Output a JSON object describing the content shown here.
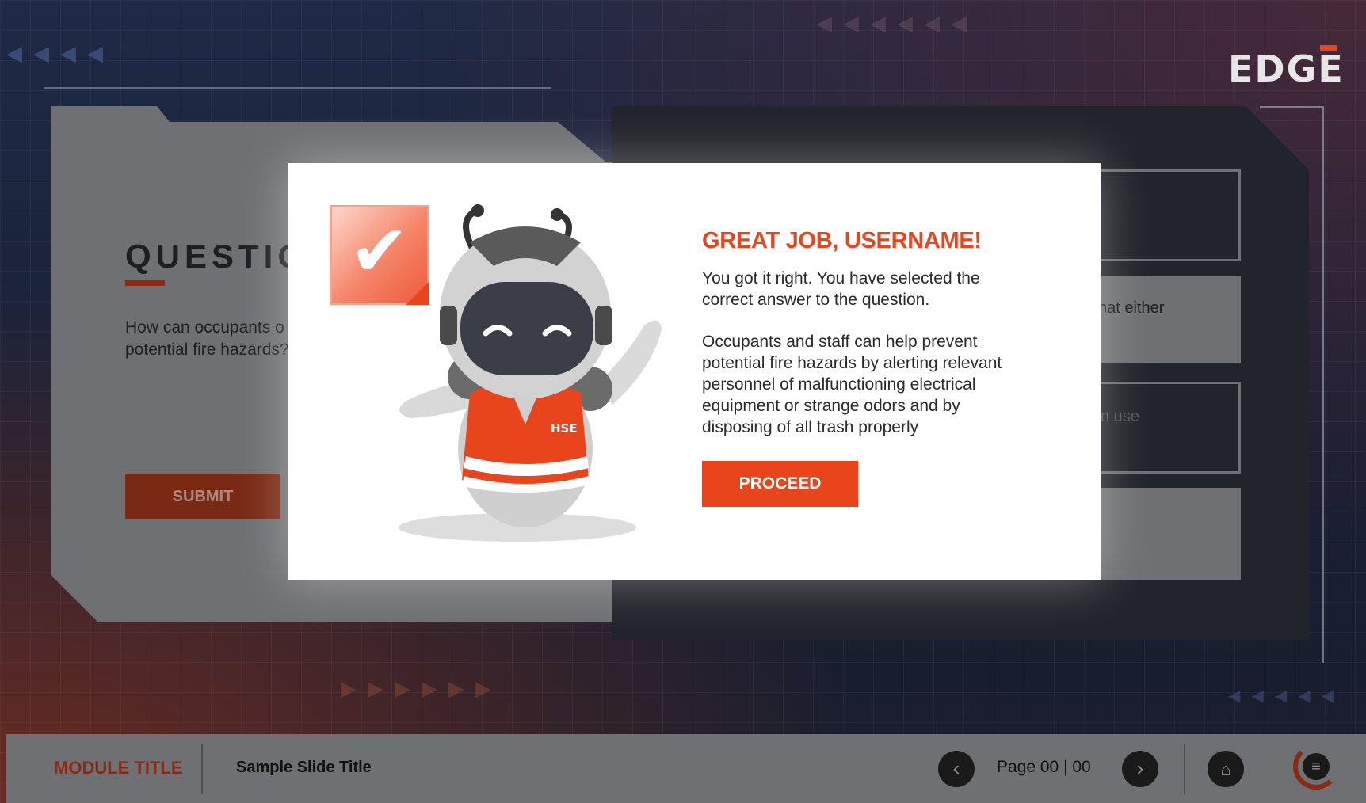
{
  "brand": {
    "logo_text": "EDGE"
  },
  "question": {
    "title": "QUESTIO",
    "text": "How can occupants o\npotential fire hazards?",
    "submit_label": "SUBMIT"
  },
  "options": [
    {
      "label": ""
    },
    {
      "label": "hat either"
    },
    {
      "label": "n use"
    },
    {
      "label": ""
    }
  ],
  "modal": {
    "title": "GREAT JOB, USERNAME!",
    "message_1": "You got it right. You have selected the\ncorrect answer to the question.",
    "message_2": "Occupants and staff can help prevent\npotential fire hazards by alerting relevant\npersonnel of malfunctioning electrical\nequipment or strange odors and by\ndisposing of all trash properly",
    "proceed_label": "PROCEED",
    "vest_text": "HSE"
  },
  "footer": {
    "module_title": "MODULE TITLE",
    "slide_title": "Sample Slide Title",
    "page_label": "Page 00  |  00"
  },
  "colors": {
    "accent": "#e8451c",
    "dark_accent": "#8a2a12",
    "panel_gray": "#6f7073",
    "background": "#1e2a46"
  },
  "icons": {
    "checkmark": "check-icon",
    "prev": "chevron-left-icon",
    "next": "chevron-right-icon",
    "home": "home-icon",
    "menu": "hamburger-icon"
  }
}
